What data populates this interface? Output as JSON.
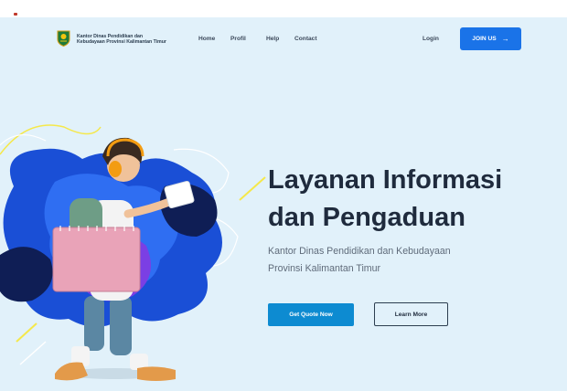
{
  "brand": {
    "line1": "Kantor Dinas Pendidikan  dan",
    "line2": "Kebudayaan Provinsi Kalimantan Timur",
    "logo_icon": "provincial-emblem-icon"
  },
  "nav": {
    "items": [
      "Home",
      "Profil",
      "Help",
      "Contact"
    ],
    "login": "Login",
    "join": "JOIN US",
    "join_icon": "arrow-right-icon"
  },
  "hero": {
    "title_line1": "Layanan Informasi",
    "title_line2": "dan Pengaduan",
    "subtitle_line1": "Kantor Dinas Pendidikan dan Kebudayaan",
    "subtitle_line2": "Provinsi Kalimantan Timur",
    "primary_button": "Get Quote Now",
    "secondary_button": "Learn More",
    "illustration": "student-walking-illustration"
  },
  "colors": {
    "hero_background": "#e1f1fa",
    "join_button": "#1a73e8",
    "primary_button": "#0d8bd1",
    "title_text": "#1f2b3d"
  }
}
